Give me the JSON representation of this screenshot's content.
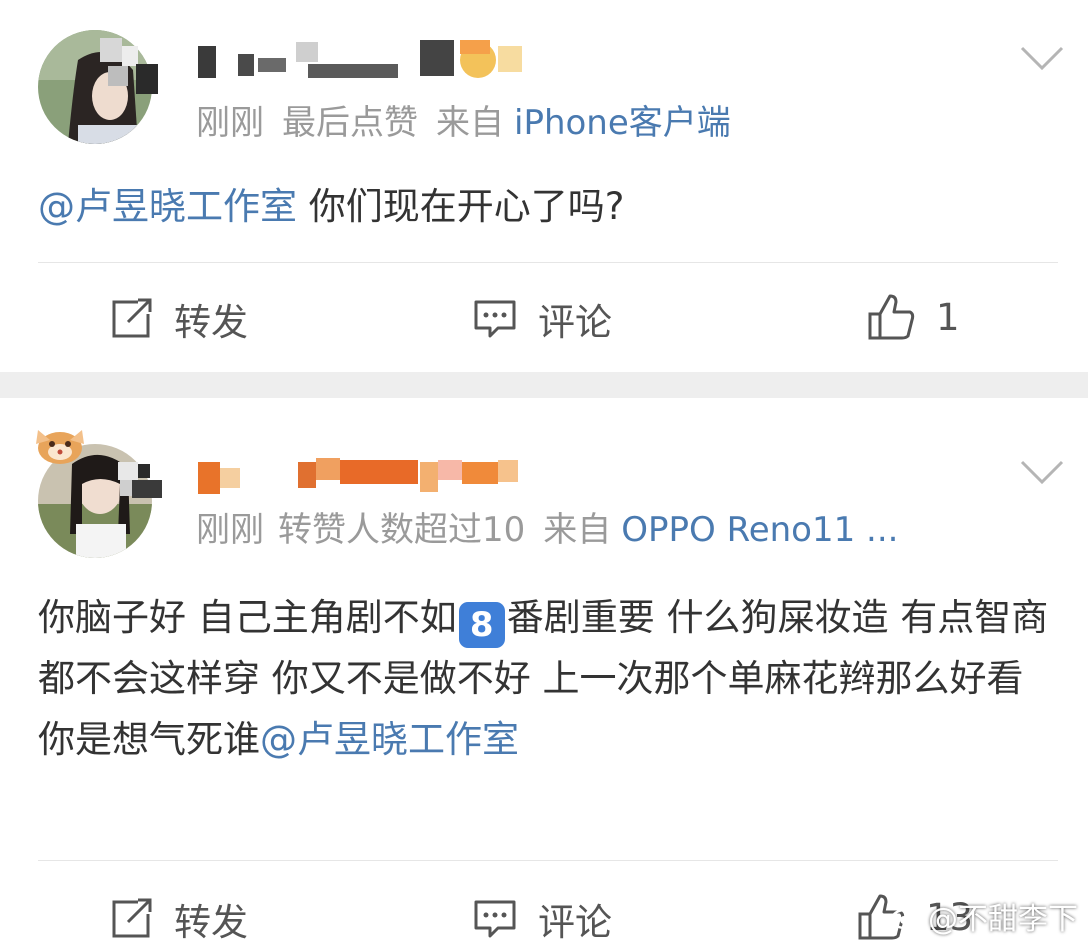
{
  "posts": [
    {
      "meta_time": "刚刚",
      "meta_note": "最后点赞",
      "meta_from": "来自",
      "meta_source": "iPhone客户端",
      "mention": "@卢昱晓工作室",
      "text": " 你们现在开心了吗?",
      "repost_label": "转发",
      "comment_label": "评论",
      "like_count": "1"
    },
    {
      "meta_time": "刚刚",
      "meta_note": "转赞人数超过10",
      "meta_from": "来自",
      "meta_source": "OPPO Reno11 ...",
      "text_before": "你脑子好 自己主角剧不如",
      "emoji_badge": "8",
      "text_after": "番剧重要 什么狗屎妆造 有点智商都不会这样穿 你又不是做不好 上一次那个单麻花辫那么好看 你是想气死谁",
      "mention": "@卢昱晓工作室",
      "repost_label": "转发",
      "comment_label": "评论",
      "like_count": "13"
    }
  ],
  "watermark": "@不甜李下",
  "icons": [
    "repost-icon",
    "comment-icon",
    "like-icon",
    "chevron-down-icon"
  ],
  "colors": {
    "link": "#4a7ab0",
    "meta": "#9a9a9a",
    "separator": "#eeeeee"
  }
}
